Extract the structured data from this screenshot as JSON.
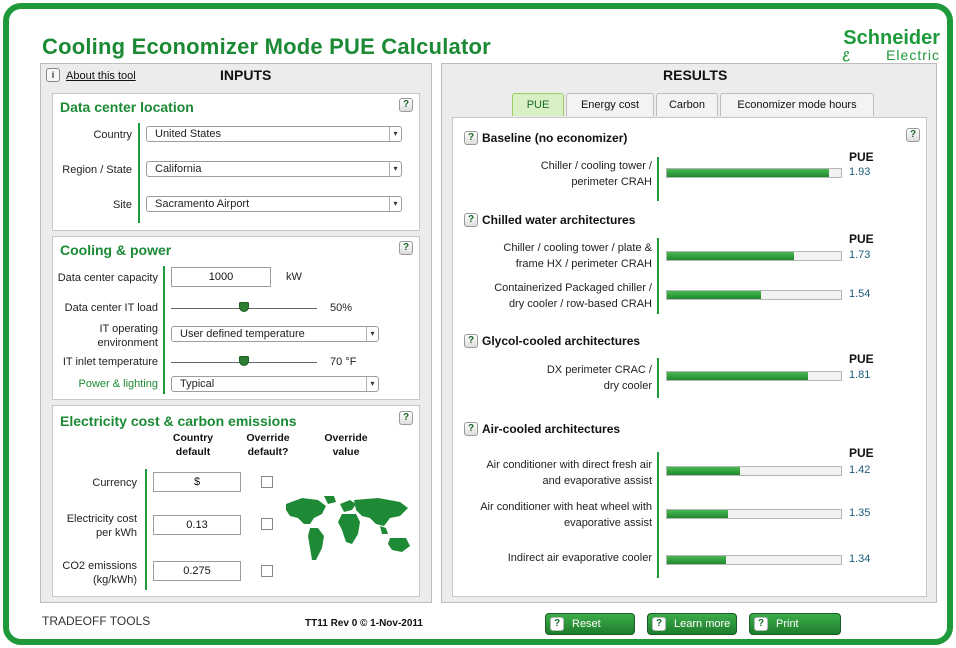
{
  "app": {
    "title": "Cooling Economizer Mode PUE Calculator",
    "brand_line1": "Schneider",
    "brand_line2": "Electric",
    "brand_color": "#1f9a3a"
  },
  "inputs": {
    "about_label": "About this tool",
    "header": "INPUTS",
    "location": {
      "title": "Data center location",
      "country_label": "Country",
      "country_value": "United States",
      "region_label": "Region / State",
      "region_value": "California",
      "site_label": "Site",
      "site_value": "Sacramento Airport"
    },
    "cooling": {
      "title": "Cooling & power",
      "capacity_label": "Data center capacity",
      "capacity_value": "1000",
      "capacity_unit": "kW",
      "it_load_label": "Data center IT load",
      "it_load_value": "50%",
      "it_load_fraction": 0.5,
      "operating_env_label": "IT operating environment",
      "operating_env_value": "User defined temperature",
      "inlet_temp_label": "IT inlet temperature",
      "inlet_temp_value": "70 °F",
      "inlet_temp_fraction": 0.5,
      "power_lighting_label": "Power & lighting",
      "power_lighting_value": "Typical"
    },
    "electricity": {
      "title": "Electricity cost & carbon emissions",
      "col_country_default": "Country default",
      "col_override": "Override default?",
      "col_override_value": "Override value",
      "currency_label": "Currency",
      "currency_value": "$",
      "cost_label": "Electricity cost per kWh",
      "cost_value": "0.13",
      "co2_label": "CO2 emissions (kg/kWh)",
      "co2_value": "0.275"
    }
  },
  "results": {
    "header": "RESULTS",
    "tabs": [
      "PUE",
      "Energy cost",
      "Carbon",
      "Economizer mode hours"
    ],
    "active_tab": "PUE",
    "pue_header": "PUE",
    "groups": [
      {
        "title": "Baseline (no economizer)",
        "rows": [
          {
            "label": "Chiller / cooling tower / perimeter CRAH",
            "value": "1.93",
            "fraction": 0.93
          }
        ]
      },
      {
        "title": "Chilled water architectures",
        "rows": [
          {
            "label": "Chiller / cooling tower / plate & frame HX / perimeter CRAH",
            "value": "1.73",
            "fraction": 0.73
          },
          {
            "label": "Containerized Packaged chiller / dry cooler / row-based CRAH",
            "value": "1.54",
            "fraction": 0.54
          }
        ]
      },
      {
        "title": "Glycol-cooled architectures",
        "rows": [
          {
            "label": "DX perimeter CRAC / dry cooler",
            "value": "1.81",
            "fraction": 0.81
          }
        ]
      },
      {
        "title": "Air-cooled architectures",
        "rows": [
          {
            "label": "Air conditioner with direct fresh air and evaporative assist",
            "value": "1.42",
            "fraction": 0.42
          },
          {
            "label": "Air conditioner with heat wheel with evaporative assist",
            "value": "1.35",
            "fraction": 0.35
          },
          {
            "label": "Indirect air evaporative cooler",
            "value": "1.34",
            "fraction": 0.34
          }
        ]
      }
    ]
  },
  "footer": {
    "tradeoff_logo": "TRADEOFF TOOLS",
    "version": "TT11 Rev 0 © 1-Nov-2011",
    "reset_label": "Reset",
    "learn_more_label": "Learn more",
    "print_label": "Print"
  }
}
